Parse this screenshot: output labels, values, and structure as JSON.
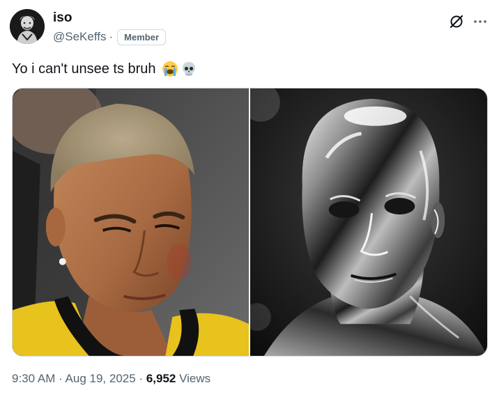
{
  "author": {
    "display_name": "iso",
    "handle": "@SeKeffs",
    "separator": "·",
    "badge": "Member"
  },
  "post": {
    "text": "Yo i can't unsee ts bruh",
    "emojis": [
      "loudly-crying-face",
      "skull"
    ]
  },
  "media": {
    "count": 2,
    "items": [
      {
        "description_icon": "photo-man-buzzcut"
      },
      {
        "description_icon": "photo-chrome-head"
      }
    ]
  },
  "meta": {
    "time": "9:30 AM",
    "sep1": " · ",
    "date": "Aug 19, 2025",
    "sep2": " · ",
    "views_count": "6,952",
    "views_label": " Views"
  },
  "icons": {
    "header_right": [
      "grok-icon",
      "more-icon"
    ]
  },
  "colors": {
    "text_primary": "#0f1419",
    "text_secondary": "#536471",
    "border": "#cfd9de",
    "background": "#ffffff"
  }
}
